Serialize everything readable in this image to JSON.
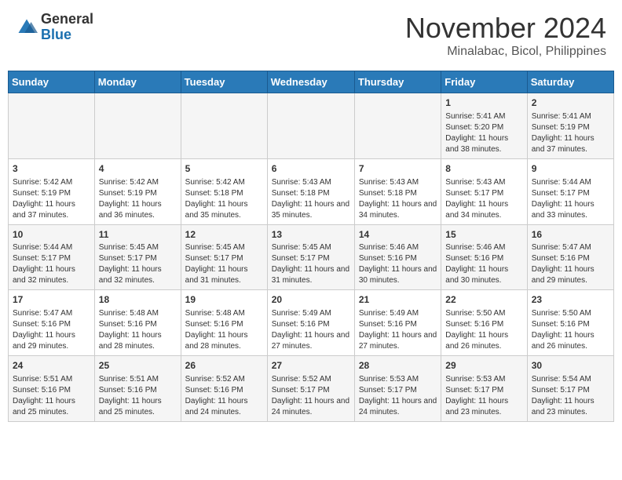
{
  "header": {
    "logo": {
      "general": "General",
      "blue": "Blue"
    },
    "month": "November 2024",
    "location": "Minalabac, Bicol, Philippines"
  },
  "weekdays": [
    "Sunday",
    "Monday",
    "Tuesday",
    "Wednesday",
    "Thursday",
    "Friday",
    "Saturday"
  ],
  "weeks": [
    [
      {
        "day": "",
        "info": ""
      },
      {
        "day": "",
        "info": ""
      },
      {
        "day": "",
        "info": ""
      },
      {
        "day": "",
        "info": ""
      },
      {
        "day": "",
        "info": ""
      },
      {
        "day": "1",
        "info": "Sunrise: 5:41 AM\nSunset: 5:20 PM\nDaylight: 11 hours and 38 minutes."
      },
      {
        "day": "2",
        "info": "Sunrise: 5:41 AM\nSunset: 5:19 PM\nDaylight: 11 hours and 37 minutes."
      }
    ],
    [
      {
        "day": "3",
        "info": "Sunrise: 5:42 AM\nSunset: 5:19 PM\nDaylight: 11 hours and 37 minutes."
      },
      {
        "day": "4",
        "info": "Sunrise: 5:42 AM\nSunset: 5:19 PM\nDaylight: 11 hours and 36 minutes."
      },
      {
        "day": "5",
        "info": "Sunrise: 5:42 AM\nSunset: 5:18 PM\nDaylight: 11 hours and 35 minutes."
      },
      {
        "day": "6",
        "info": "Sunrise: 5:43 AM\nSunset: 5:18 PM\nDaylight: 11 hours and 35 minutes."
      },
      {
        "day": "7",
        "info": "Sunrise: 5:43 AM\nSunset: 5:18 PM\nDaylight: 11 hours and 34 minutes."
      },
      {
        "day": "8",
        "info": "Sunrise: 5:43 AM\nSunset: 5:17 PM\nDaylight: 11 hours and 34 minutes."
      },
      {
        "day": "9",
        "info": "Sunrise: 5:44 AM\nSunset: 5:17 PM\nDaylight: 11 hours and 33 minutes."
      }
    ],
    [
      {
        "day": "10",
        "info": "Sunrise: 5:44 AM\nSunset: 5:17 PM\nDaylight: 11 hours and 32 minutes."
      },
      {
        "day": "11",
        "info": "Sunrise: 5:45 AM\nSunset: 5:17 PM\nDaylight: 11 hours and 32 minutes."
      },
      {
        "day": "12",
        "info": "Sunrise: 5:45 AM\nSunset: 5:17 PM\nDaylight: 11 hours and 31 minutes."
      },
      {
        "day": "13",
        "info": "Sunrise: 5:45 AM\nSunset: 5:17 PM\nDaylight: 11 hours and 31 minutes."
      },
      {
        "day": "14",
        "info": "Sunrise: 5:46 AM\nSunset: 5:16 PM\nDaylight: 11 hours and 30 minutes."
      },
      {
        "day": "15",
        "info": "Sunrise: 5:46 AM\nSunset: 5:16 PM\nDaylight: 11 hours and 30 minutes."
      },
      {
        "day": "16",
        "info": "Sunrise: 5:47 AM\nSunset: 5:16 PM\nDaylight: 11 hours and 29 minutes."
      }
    ],
    [
      {
        "day": "17",
        "info": "Sunrise: 5:47 AM\nSunset: 5:16 PM\nDaylight: 11 hours and 29 minutes."
      },
      {
        "day": "18",
        "info": "Sunrise: 5:48 AM\nSunset: 5:16 PM\nDaylight: 11 hours and 28 minutes."
      },
      {
        "day": "19",
        "info": "Sunrise: 5:48 AM\nSunset: 5:16 PM\nDaylight: 11 hours and 28 minutes."
      },
      {
        "day": "20",
        "info": "Sunrise: 5:49 AM\nSunset: 5:16 PM\nDaylight: 11 hours and 27 minutes."
      },
      {
        "day": "21",
        "info": "Sunrise: 5:49 AM\nSunset: 5:16 PM\nDaylight: 11 hours and 27 minutes."
      },
      {
        "day": "22",
        "info": "Sunrise: 5:50 AM\nSunset: 5:16 PM\nDaylight: 11 hours and 26 minutes."
      },
      {
        "day": "23",
        "info": "Sunrise: 5:50 AM\nSunset: 5:16 PM\nDaylight: 11 hours and 26 minutes."
      }
    ],
    [
      {
        "day": "24",
        "info": "Sunrise: 5:51 AM\nSunset: 5:16 PM\nDaylight: 11 hours and 25 minutes."
      },
      {
        "day": "25",
        "info": "Sunrise: 5:51 AM\nSunset: 5:16 PM\nDaylight: 11 hours and 25 minutes."
      },
      {
        "day": "26",
        "info": "Sunrise: 5:52 AM\nSunset: 5:16 PM\nDaylight: 11 hours and 24 minutes."
      },
      {
        "day": "27",
        "info": "Sunrise: 5:52 AM\nSunset: 5:17 PM\nDaylight: 11 hours and 24 minutes."
      },
      {
        "day": "28",
        "info": "Sunrise: 5:53 AM\nSunset: 5:17 PM\nDaylight: 11 hours and 24 minutes."
      },
      {
        "day": "29",
        "info": "Sunrise: 5:53 AM\nSunset: 5:17 PM\nDaylight: 11 hours and 23 minutes."
      },
      {
        "day": "30",
        "info": "Sunrise: 5:54 AM\nSunset: 5:17 PM\nDaylight: 11 hours and 23 minutes."
      }
    ]
  ]
}
